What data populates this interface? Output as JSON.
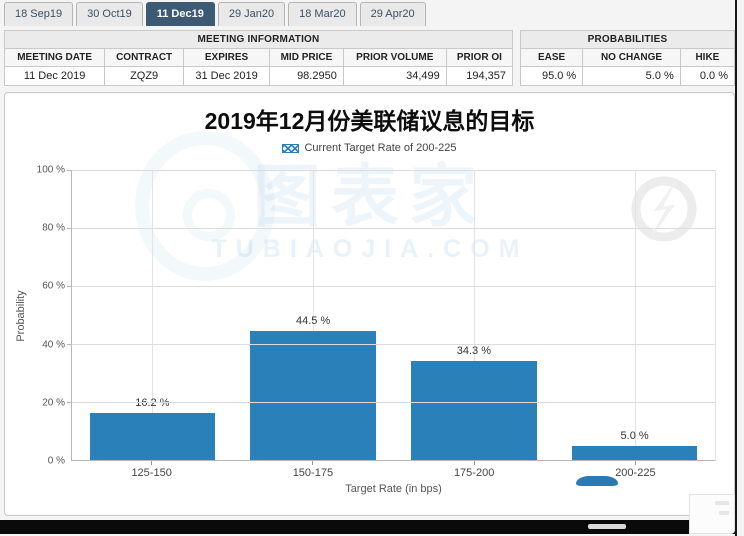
{
  "tabs": [
    {
      "label": "18 Sep19",
      "selected": false
    },
    {
      "label": "30 Oct19",
      "selected": false
    },
    {
      "label": "11 Dec19",
      "selected": true
    },
    {
      "label": "29 Jan20",
      "selected": false
    },
    {
      "label": "18 Mar20",
      "selected": false
    },
    {
      "label": "29 Apr20",
      "selected": false
    }
  ],
  "meeting_info": {
    "title": "MEETING INFORMATION",
    "columns": [
      "MEETING DATE",
      "CONTRACT",
      "EXPIRES",
      "MID PRICE",
      "PRIOR VOLUME",
      "PRIOR OI"
    ],
    "row": [
      "11 Dec 2019",
      "ZQZ9",
      "31 Dec 2019",
      "98.2950",
      "34,499",
      "194,357"
    ],
    "numeric_columns": [
      3,
      4,
      5
    ]
  },
  "probabilities": {
    "title": "PROBABILITIES",
    "columns": [
      "EASE",
      "NO CHANGE",
      "HIKE"
    ],
    "row": [
      "95.0 %",
      "5.0 %",
      "0.0 %"
    ]
  },
  "chart_data": {
    "type": "bar",
    "title": "2019年12月份美联储议息的目标",
    "legend": "Current Target Rate of 200-225",
    "legend_position": "top",
    "categories": [
      "125-150",
      "150-175",
      "175-200",
      "200-225"
    ],
    "values": [
      16.2,
      44.5,
      34.3,
      5.0
    ],
    "bar_labels": [
      "16.2 %",
      "44.5 %",
      "34.3 %",
      "5.0 %"
    ],
    "hatched_index": 3,
    "xlabel": "Target Rate (in bps)",
    "ylabel": "Probability",
    "ylim": [
      0,
      100
    ],
    "ytick_step": 20,
    "yticks": [
      "100 %",
      "80 %",
      "60 %",
      "40 %",
      "20 %",
      "0 %"
    ],
    "grid": true,
    "bar_color": "#2a80b9"
  },
  "watermark": {
    "cn": "图表家",
    "en": "TUBIAOJIA.COM"
  },
  "colors": {
    "accent": "#2a80b9",
    "tab_selected_bg": "#3c5a74",
    "bar_color": "#2a80b9"
  }
}
